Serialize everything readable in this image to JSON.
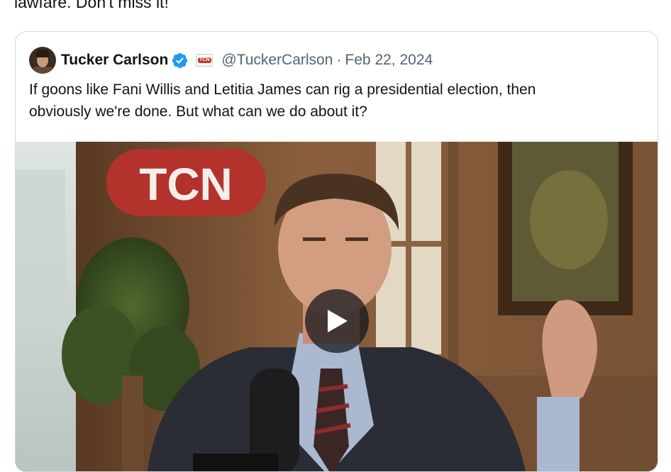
{
  "post": {
    "text_fragment": "lawfare. Don't miss it!"
  },
  "quoted_tweet": {
    "author_name": "Tucker Carlson",
    "handle": "@TuckerCarlson",
    "separator": "·",
    "date": "Feb 22, 2024",
    "text_lines": [
      "If goons like Fani Willis and Letitia James can rig a presidential election, then",
      "obviously we're done. But what can we do about it?"
    ],
    "verified_icon": "verified-badge-icon",
    "affiliate_badge": {
      "label": "TCN"
    },
    "media": {
      "type": "video",
      "sign_text": "TCN",
      "play_icon": "play-icon"
    }
  },
  "colors": {
    "text": "#0f1419",
    "secondary_text": "#536471",
    "border": "#cfd9de",
    "verified": "#1d9bf0",
    "sign_red": "#b3322b"
  }
}
